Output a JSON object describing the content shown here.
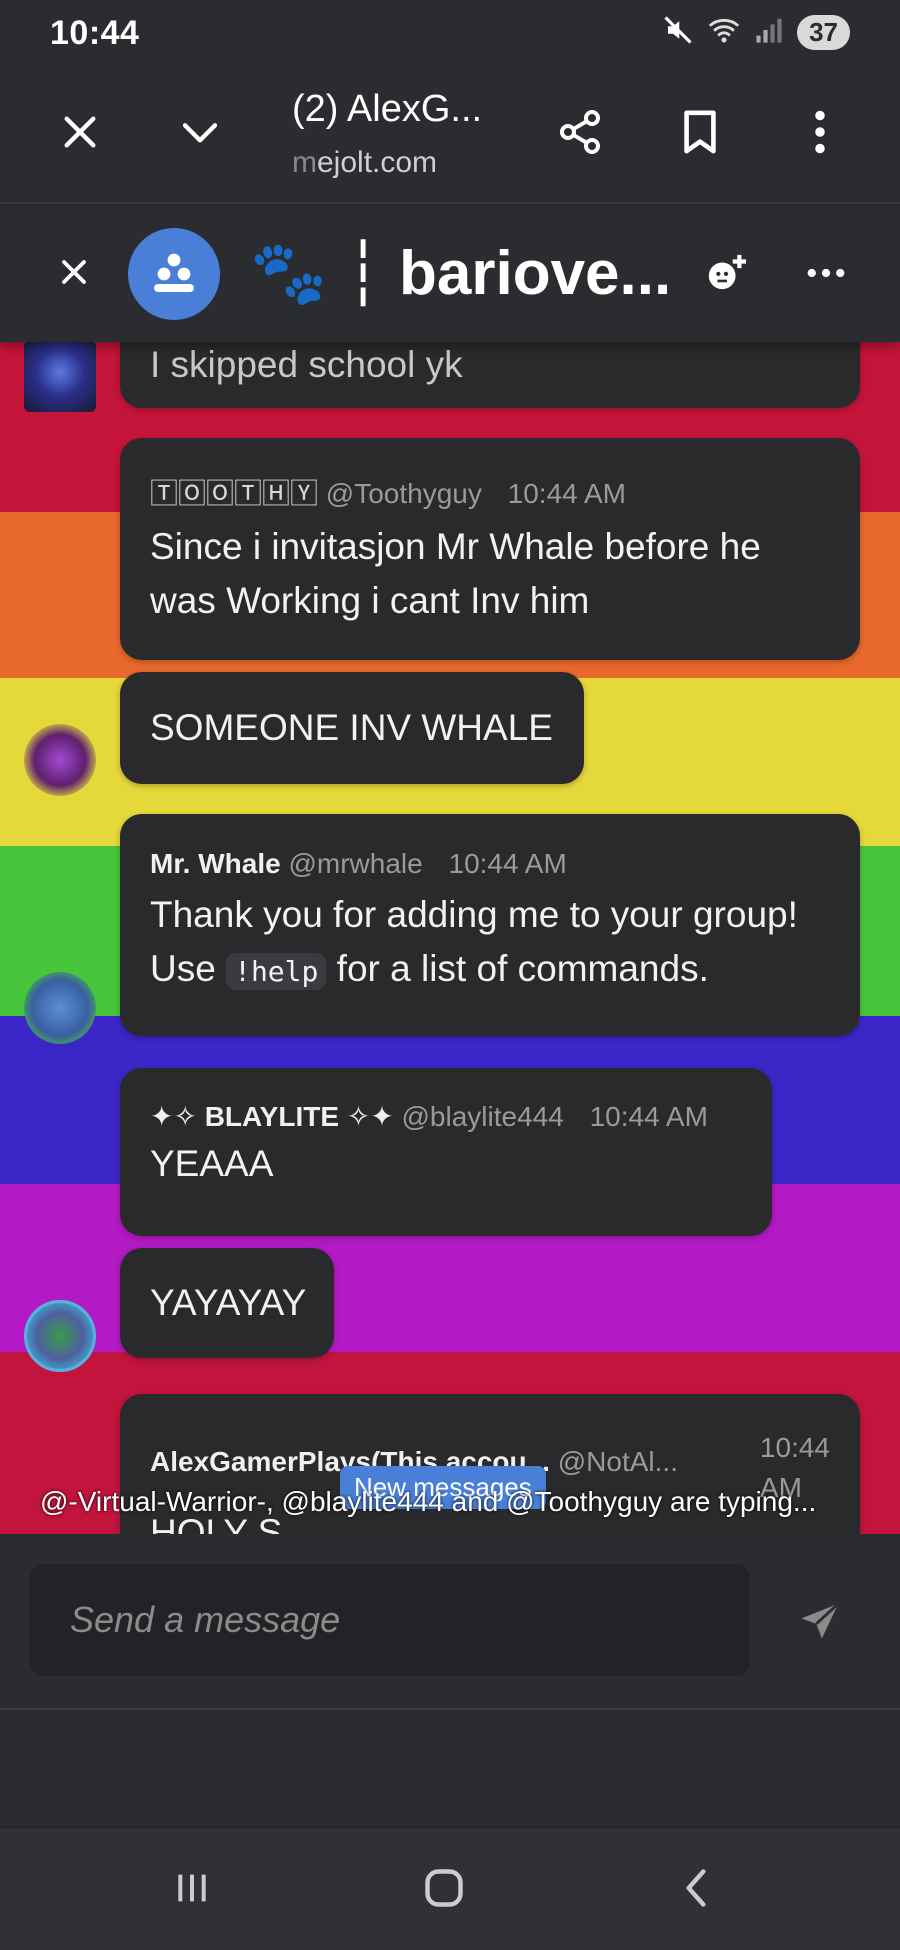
{
  "status": {
    "time": "10:44",
    "battery": "37"
  },
  "browser": {
    "tab_title": "(2) AlexG...",
    "url_faded": "m",
    "url_rest": "ejolt.com"
  },
  "chat": {
    "title_emoji": "🐾",
    "title_sep": "┆",
    "title": "bariove..."
  },
  "messages": [
    {
      "id": "m0",
      "text": "I skipped school yk"
    },
    {
      "id": "m1",
      "username": "🅃🄾🄾🅃🄷🅈",
      "handle": "@Toothyguy",
      "time": "10:44 AM",
      "text": "Since i invitasjon Mr Whale before he was Working i cant Inv him"
    },
    {
      "id": "m2",
      "text": "SOMEONE INV WHALE"
    },
    {
      "id": "m3",
      "username": "Mr. Whale",
      "handle": "@mrwhale",
      "time": "10:44 AM",
      "text_before": "Thank you for adding me to your group! Use",
      "code": "!help",
      "text_after": "for a list of commands."
    },
    {
      "id": "m4",
      "username": "✦✧ BLAYLITE ✧✦",
      "handle": "@blaylite444",
      "time": "10:44 AM",
      "text": "YEAAA"
    },
    {
      "id": "m5",
      "text": "YAYAYAY"
    },
    {
      "id": "m6",
      "username": "AlexGamerPlays(This accou...",
      "handle": "@NotAl...",
      "time_line1": "10:44",
      "time_line2": "AM",
      "text": "HOLY S"
    }
  ],
  "typing_indicator": "@-Virtual-Warrior-, @blaylite444 and @Toothyguy are typing...",
  "new_messages_label": "New messages",
  "composer": {
    "placeholder": "Send a message"
  },
  "colors": {
    "accent": "#4a7fd8",
    "bubble": "#2a2a2c",
    "chrome": "#2b2c30"
  },
  "icons": [
    "close-icon",
    "chevron-down-icon",
    "share-icon",
    "bookmark-icon",
    "more-vert-icon",
    "group-icon",
    "add-member-icon",
    "more-horiz-icon",
    "send-icon",
    "recents-icon",
    "home-icon",
    "back-icon",
    "mute-icon",
    "wifi-icon",
    "signal-icon"
  ]
}
